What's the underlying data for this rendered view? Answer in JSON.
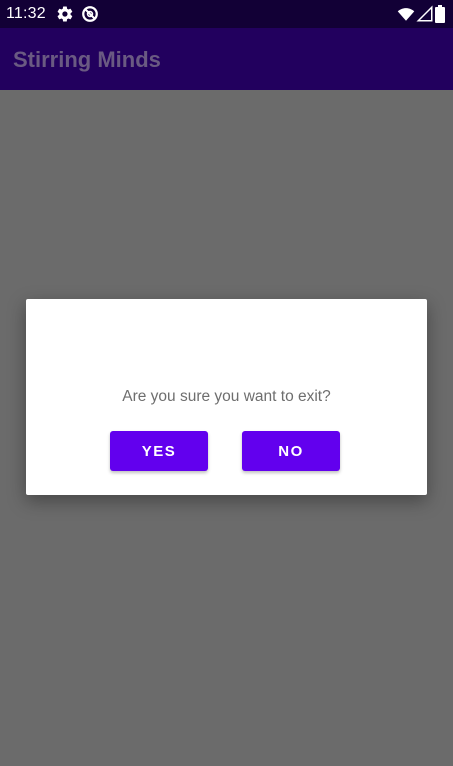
{
  "status_bar": {
    "time": "11:32",
    "icons": [
      "gear-icon",
      "blocked-icon",
      "wifi-icon",
      "signal-icon",
      "battery-icon"
    ]
  },
  "app_bar": {
    "title": "Stirring Minds"
  },
  "dialog": {
    "message": "Are you sure you want to exit?",
    "yes_label": "YES",
    "no_label": "NO"
  },
  "colors": {
    "status_bar": "#120036",
    "app_bar": "#22005e",
    "app_title": "#6a5a82",
    "scrim": "#6b6b6b",
    "dialog_bg": "#ffffff",
    "accent": "#6200ee",
    "message_text": "#6e6e6e"
  }
}
